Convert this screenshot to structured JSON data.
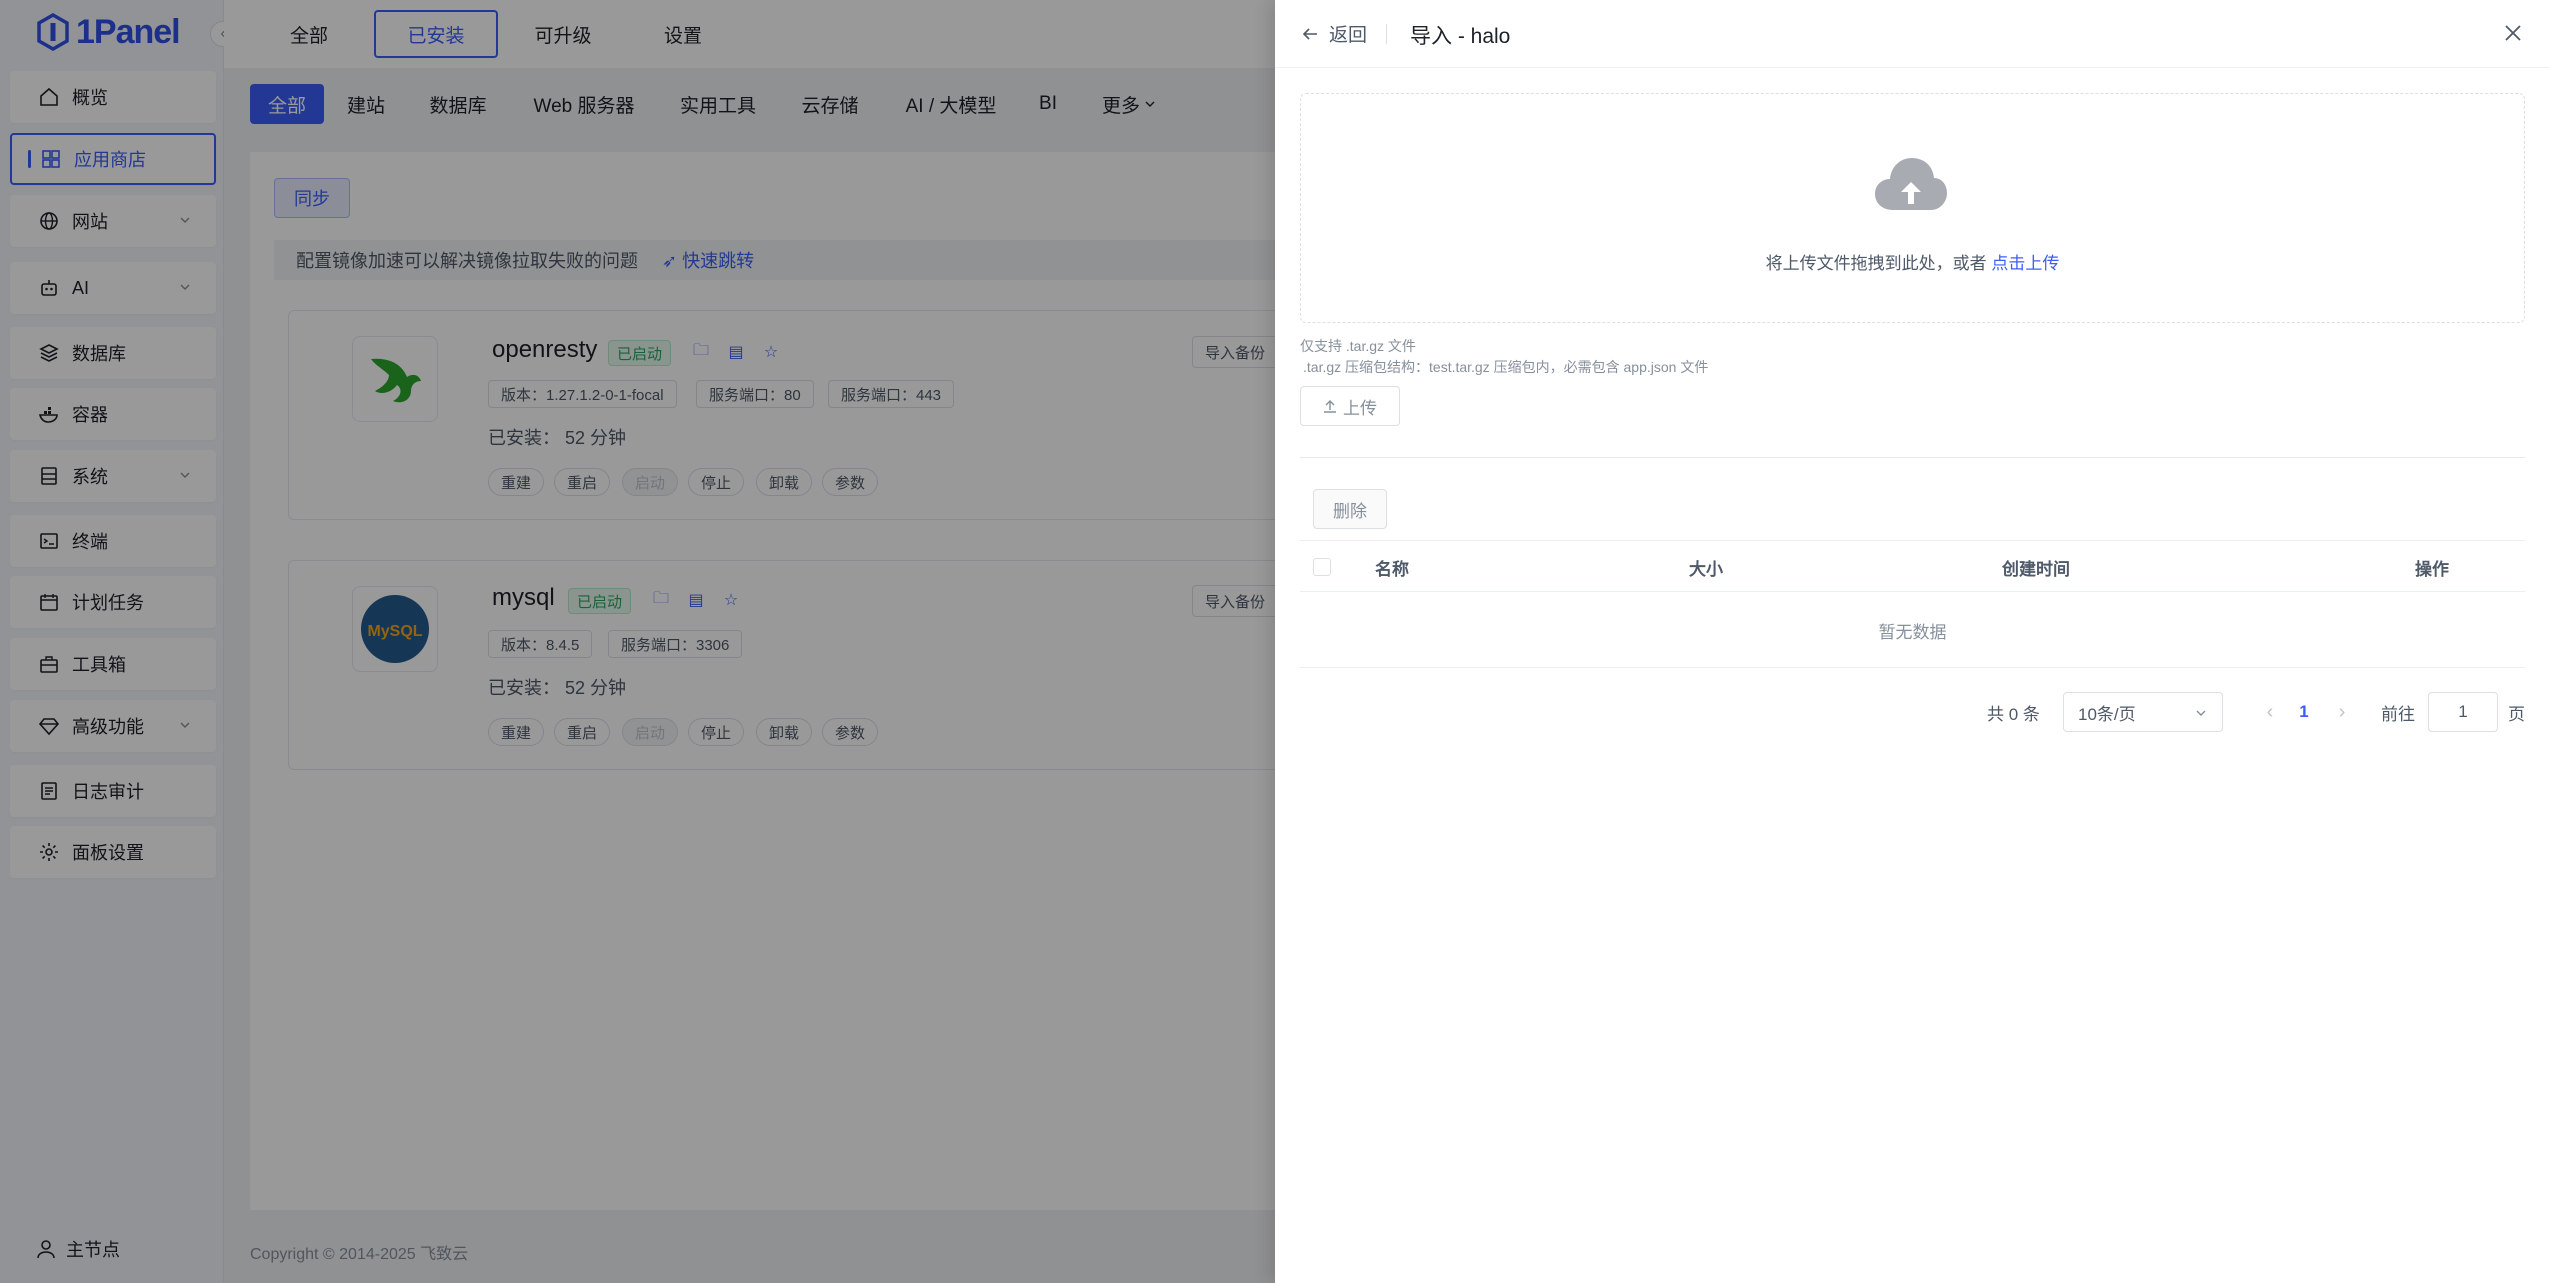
{
  "brand": {
    "name": "1Panel"
  },
  "sidebar": {
    "items": [
      {
        "label": "概览",
        "icon": "home-icon"
      },
      {
        "label": "应用商店",
        "icon": "apps-grid-icon",
        "active": true
      },
      {
        "label": "网站",
        "icon": "globe-icon",
        "expandable": true
      },
      {
        "label": "AI",
        "icon": "robot-icon",
        "expandable": true
      },
      {
        "label": "数据库",
        "icon": "layers-icon"
      },
      {
        "label": "容器",
        "icon": "docker-icon"
      },
      {
        "label": "系统",
        "icon": "server-icon",
        "expandable": true
      },
      {
        "label": "终端",
        "icon": "terminal-icon"
      },
      {
        "label": "计划任务",
        "icon": "calendar-icon"
      },
      {
        "label": "工具箱",
        "icon": "toolbox-icon"
      },
      {
        "label": "高级功能",
        "icon": "diamond-icon",
        "expandable": true
      },
      {
        "label": "日志审计",
        "icon": "log-icon"
      },
      {
        "label": "面板设置",
        "icon": "gear-icon"
      }
    ],
    "footer_node": "主节点"
  },
  "top_tabs": [
    "全部",
    "已安装",
    "可升级",
    "设置"
  ],
  "active_top_tab": "已安装",
  "categories": [
    "全部",
    "建站",
    "数据库",
    "Web 服务器",
    "实用工具",
    "云存储",
    "AI / 大模型",
    "BI",
    "更多"
  ],
  "sync_label": "同步",
  "notice": {
    "text": "配置镜像加速可以解决镜像拉取失败的问题",
    "link": "快速跳转"
  },
  "apps": [
    {
      "name": "openresty",
      "status": "已启动",
      "version": "版本：1.27.1.2-0-1-focal",
      "ports": [
        "服务端口：80",
        "服务端口：443"
      ],
      "installed": "已安装：  52 分钟",
      "actions": [
        "重建",
        "重启",
        "启动",
        "停止",
        "卸载",
        "参数"
      ],
      "backup": "导入备份"
    },
    {
      "name": "mysql",
      "status": "已启动",
      "version": "版本：8.4.5",
      "ports": [
        "服务端口：3306"
      ],
      "installed": "已安装：  52 分钟",
      "actions": [
        "重建",
        "重启",
        "启动",
        "停止",
        "卸载",
        "参数"
      ],
      "backup": "导入备份"
    }
  ],
  "copyright": "Copyright © 2014-2025 飞致云",
  "drawer": {
    "back": "返回",
    "title": "导入 - halo",
    "dropzone_text": "将上传文件拖拽到此处，或者",
    "dropzone_link": "点击上传",
    "hint1": "仅支持 .tar.gz 文件",
    "hint2": ".tar.gz 压缩包结构：test.tar.gz 压缩包内，必需包含 app.json 文件",
    "upload": "上传",
    "delete": "删除",
    "columns": [
      "名称",
      "大小",
      "创建时间",
      "操作"
    ],
    "empty": "暂无数据",
    "total": "共 0 条",
    "page_size": "10条/页",
    "current_page": "1",
    "goto_label": "前往",
    "goto_value": "1",
    "page_suffix": "页"
  },
  "colors": {
    "accent": "#3b5ef7",
    "success": "#2ca25f"
  }
}
